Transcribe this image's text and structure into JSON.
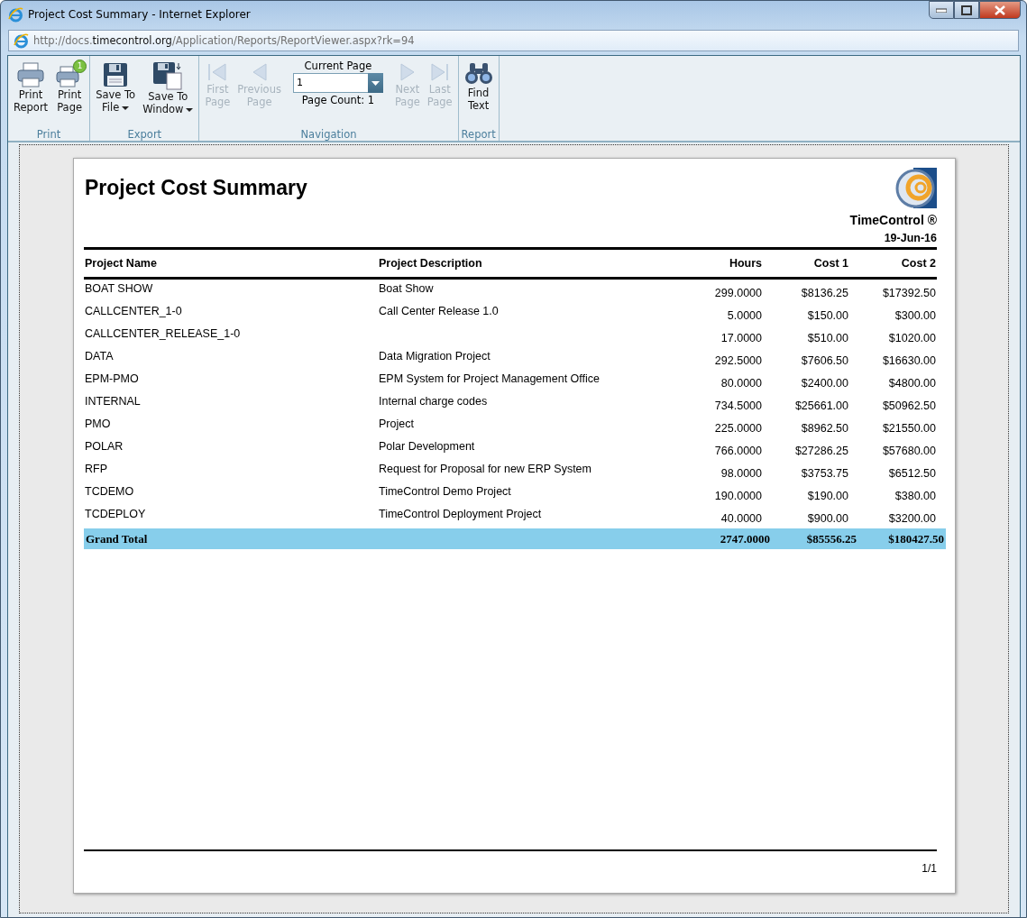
{
  "window": {
    "title": "Project Cost Summary - Internet Explorer",
    "address": "http://docs.**timecontrol.org**/Application/Reports/ReportViewer.aspx?rk=94"
  },
  "toolbar": {
    "groups": [
      {
        "label": "Print",
        "items": [
          {
            "kind": "button",
            "label": "Print\nReport",
            "disabled": false,
            "dropdown": false
          },
          {
            "kind": "button",
            "badge": "1",
            "label": "Print\nPage",
            "disabled": false,
            "dropdown": false
          }
        ]
      },
      {
        "label": "Export",
        "items": [
          {
            "kind": "button",
            "label": "Save To\nFile",
            "disabled": false,
            "dropdown": true
          },
          {
            "kind": "button",
            "label": "Save To\nWindow",
            "disabled": false,
            "dropdown": true
          }
        ]
      },
      {
        "label": "Navigation",
        "items": [
          {
            "kind": "button",
            "label": "First\nPage",
            "disabled": true,
            "dropdown": false
          },
          {
            "kind": "button",
            "label": "Previous\nPage",
            "disabled": true,
            "dropdown": false
          },
          {
            "kind": "page-selector",
            "label": "Current Page",
            "value": "1",
            "count": "Page Count: 1"
          },
          {
            "kind": "button",
            "label": "Next\nPage",
            "disabled": true,
            "dropdown": false
          },
          {
            "kind": "button",
            "label": "Last\nPage",
            "disabled": true,
            "dropdown": false
          }
        ]
      },
      {
        "label": "Report",
        "items": [
          {
            "kind": "button",
            "label": "Find\nText",
            "disabled": false,
            "dropdown": false
          }
        ]
      }
    ]
  },
  "report": {
    "title": "Project Cost Summary",
    "company": "TimeControl ®",
    "date": "19-Jun-16",
    "columns": [
      "Project Name",
      "Project Description",
      "Hours",
      "Cost 1",
      "Cost 2"
    ],
    "rows": [
      [
        "BOAT SHOW",
        "Boat Show",
        "299.0000",
        "$8136.25",
        "$17392.50"
      ],
      [
        "CALLCENTER_1-0",
        "Call Center Release 1.0",
        "5.0000",
        "$150.00",
        "$300.00"
      ],
      [
        "CALLCENTER_RELEASE_1-0",
        "",
        "17.0000",
        "$510.00",
        "$1020.00"
      ],
      [
        "DATA",
        "Data Migration Project",
        "292.5000",
        "$7606.50",
        "$16630.00"
      ],
      [
        "EPM-PMO",
        "EPM System for Project Management Office",
        "80.0000",
        "$2400.00",
        "$4800.00"
      ],
      [
        "INTERNAL",
        "Internal charge codes",
        "734.5000",
        "$25661.00",
        "$50962.50"
      ],
      [
        "PMO",
        "Project",
        "225.0000",
        "$8962.50",
        "$21550.00"
      ],
      [
        "POLAR",
        "Polar Development",
        "766.0000",
        "$27286.25",
        "$57680.00"
      ],
      [
        "RFP",
        "Request for Proposal for new ERP System",
        "98.0000",
        "$3753.75",
        "$6512.50"
      ],
      [
        "TCDEMO",
        "TimeControl Demo Project",
        "190.0000",
        "$190.00",
        "$380.00"
      ],
      [
        "TCDEPLOY",
        "TimeControl Deployment Project",
        "40.0000",
        "$900.00",
        "$3200.00"
      ]
    ],
    "total": {
      "label": "Grand Total",
      "values": [
        "2747.0000",
        "$85556.25",
        "$180427.50"
      ]
    },
    "page_number": "1/1"
  }
}
